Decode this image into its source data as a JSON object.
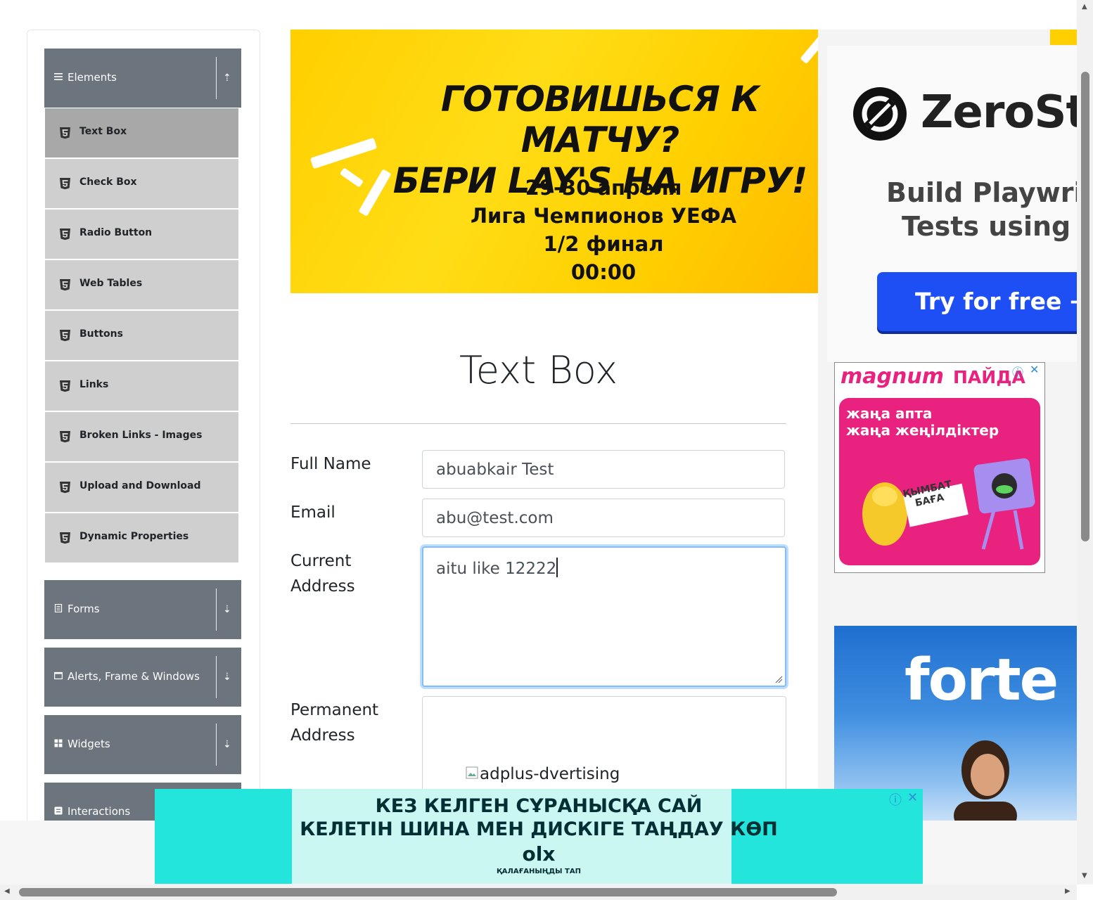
{
  "sidebar": {
    "elements_group": {
      "label": "Elements",
      "icon": "list-icon",
      "arrow": "⇡"
    },
    "items": [
      {
        "label": "Text Box",
        "active": true
      },
      {
        "label": "Check Box"
      },
      {
        "label": "Radio Button"
      },
      {
        "label": "Web Tables"
      },
      {
        "label": "Buttons"
      },
      {
        "label": "Links"
      },
      {
        "label": "Broken Links - Images"
      },
      {
        "label": "Upload and Download"
      },
      {
        "label": "Dynamic Properties"
      }
    ],
    "groups": [
      {
        "label": "Forms",
        "icon": "form-icon",
        "arrow": "⇣"
      },
      {
        "label": "Alerts, Frame & Windows",
        "icon": "window-icon",
        "arrow": "⇣"
      },
      {
        "label": "Widgets",
        "icon": "widgets-icon",
        "arrow": "⇣"
      },
      {
        "label": "Interactions",
        "icon": "interactions-icon",
        "arrow": ""
      }
    ]
  },
  "top_ad": {
    "headline1": "ГОТОВИШЬСЯ К МАТЧУ?",
    "headline2": "БЕРИ LAY'S НА ИГРУ!",
    "date": "29-30 апреля",
    "league": "Лига Чемпионов УЕФА",
    "stage": "1/2 финал",
    "time": "00:00"
  },
  "main": {
    "title": "Text Box",
    "full_name_label": "Full Name",
    "full_name_value": "abuabkair Test",
    "email_label": "Email",
    "email_value": "abu@test.com",
    "current_address_label_1": "Current",
    "current_address_label_2": "Address",
    "current_address_value": "aitu like 12222",
    "permanent_address_label_1": "Permanent",
    "permanent_address_label_2": "Address",
    "broken_image_alt": "adplus-dvertising"
  },
  "right_ads": {
    "zerostep": {
      "brand": "ZeroSte",
      "line1": "Build Playwrigl",
      "line2": "Tests using A",
      "cta": "Try for free →"
    },
    "magnum": {
      "brand": "magnum",
      "brand2": "ПАЙДА",
      "line1": "жаңа апта",
      "line2": "жаңа жеңілдіктер",
      "sticker": "ҚЫМБАТ БАҒА"
    },
    "forte": {
      "brand": "forte"
    }
  },
  "bottom_ad": {
    "line1": "КЕЗ КЕЛГЕН СҰРАНЫСҚА САЙ",
    "line2": "КЕЛЕТІН ШИНА МЕН ДИСКІГЕ ТАҢДАУ КӨП",
    "logo": "olx",
    "tagline": "ҚАЛАҒАНЫҢДЫ ТАП"
  },
  "colors": {
    "sidebar_header": "#6c757d",
    "menu_item": "#cfcfcf",
    "menu_active": "#a8a8a8",
    "focus_border": "#80bdff",
    "zerostep_cta": "#1d4ff5",
    "magnum_pink": "#e9217f",
    "olx_teal": "#23e5db"
  }
}
